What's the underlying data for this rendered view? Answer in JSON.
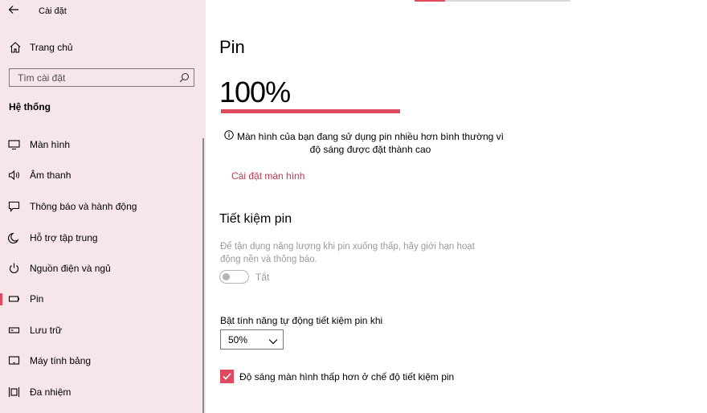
{
  "window": {
    "title": "Cài đặt"
  },
  "sidebar": {
    "home_label": "Trang chủ",
    "search_placeholder": "Tìm cài đặt",
    "section_title": "Hệ thống",
    "items": [
      {
        "label": "Màn hình",
        "icon": "monitor-icon"
      },
      {
        "label": "Âm thanh",
        "icon": "speaker-icon"
      },
      {
        "label": "Thông báo và hành động",
        "icon": "notification-icon"
      },
      {
        "label": "Hỗ trợ tập trung",
        "icon": "moon-icon"
      },
      {
        "label": "Nguồn điện và ngủ",
        "icon": "power-icon"
      },
      {
        "label": "Pin",
        "icon": "battery-icon",
        "selected": true
      },
      {
        "label": "Lưu trữ",
        "icon": "storage-icon"
      },
      {
        "label": "Máy tính bảng",
        "icon": "tablet-icon"
      },
      {
        "label": "Đa nhiệm",
        "icon": "multitask-icon"
      }
    ]
  },
  "main": {
    "title": "Pin",
    "battery_percent_text": "100%",
    "battery_level": 1.0,
    "info_text": "Màn hình của bạn đang sử dụng pin nhiều hơn bình thường vì độ sáng được đặt thành cao",
    "display_settings_link": "Cài đặt màn hình",
    "saver_title": "Tiết kiệm pin",
    "saver_description": "Để tận dụng năng lượng khi pin xuống thấp, hãy giới hạn hoạt động nền và thông báo.",
    "saver_toggle_state": "Tắt",
    "auto_saver_label": "Bật tính năng tự động tiết kiệm pin khi",
    "auto_saver_value": "50%",
    "lower_brightness_label": "Độ sáng màn hình thấp hơn ở chế độ tiết kiệm pin",
    "lower_brightness_checked": true
  },
  "colors": {
    "accent": "#e04a5f",
    "sidebar_bg": "#f6e6e9",
    "disabled_text": "#9a9a9a"
  }
}
